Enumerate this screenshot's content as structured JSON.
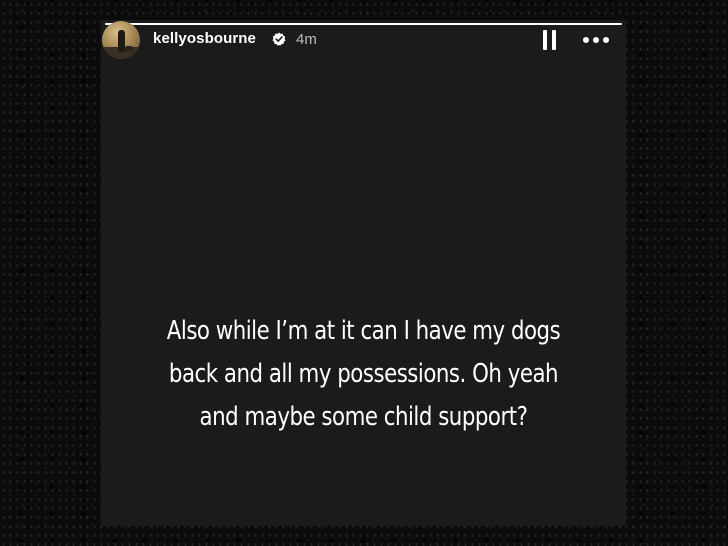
{
  "story": {
    "progress_fraction": 1.0,
    "username": "kellyosbourne",
    "verified": true,
    "time_posted": "4m",
    "text_lines": [
      "Also while I’m at it can I have my dogs",
      "back and all my possessions. Oh yeah",
      "and maybe some child support?"
    ]
  },
  "icons": {
    "verified": "verified-badge-icon",
    "pause": "pause-icon",
    "more": "more-options-icon"
  },
  "colors": {
    "background": "#0c0c0c",
    "story_background": "#1b1b1b",
    "text": "#ffffff",
    "time_text": "#bdbdbd"
  }
}
